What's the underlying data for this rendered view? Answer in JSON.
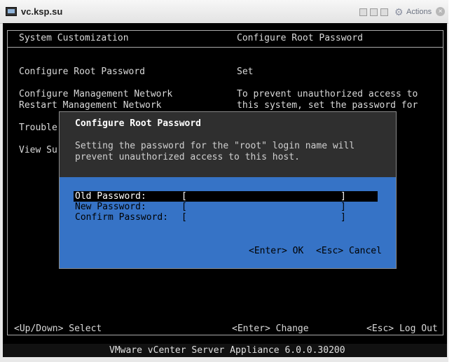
{
  "window": {
    "title": "vc.ksp.su",
    "actions_label": "Actions"
  },
  "console": {
    "header_left": "System Customization",
    "header_right": "Configure Root Password",
    "menu": [
      "Configure Root Password",
      "Configure Management Network",
      "Restart Management Network",
      "Trouble",
      "View Su"
    ],
    "status_value": "Set",
    "description": [
      "To prevent unauthorized access to",
      "this system, set the password for"
    ],
    "footer": {
      "select_hint": "<Up/Down> Select",
      "change_hint": "<Enter> Change",
      "logout_hint": "<Esc> Log Out"
    },
    "product_line": "VMware vCenter Server Appliance 6.0.0.30200"
  },
  "dialog": {
    "title": "Configure Root Password",
    "message": [
      "Setting the password for the \"root\" login name will",
      "prevent unauthorized access to this host."
    ],
    "fields": [
      {
        "label": "Old Password:",
        "value": "[                            ]"
      },
      {
        "label": "New Password:",
        "value": "[                            ]"
      },
      {
        "label": "Confirm Password:",
        "value": "[                            ]"
      }
    ],
    "ok_label": "<Enter> OK",
    "cancel_label": "<Esc> Cancel"
  }
}
